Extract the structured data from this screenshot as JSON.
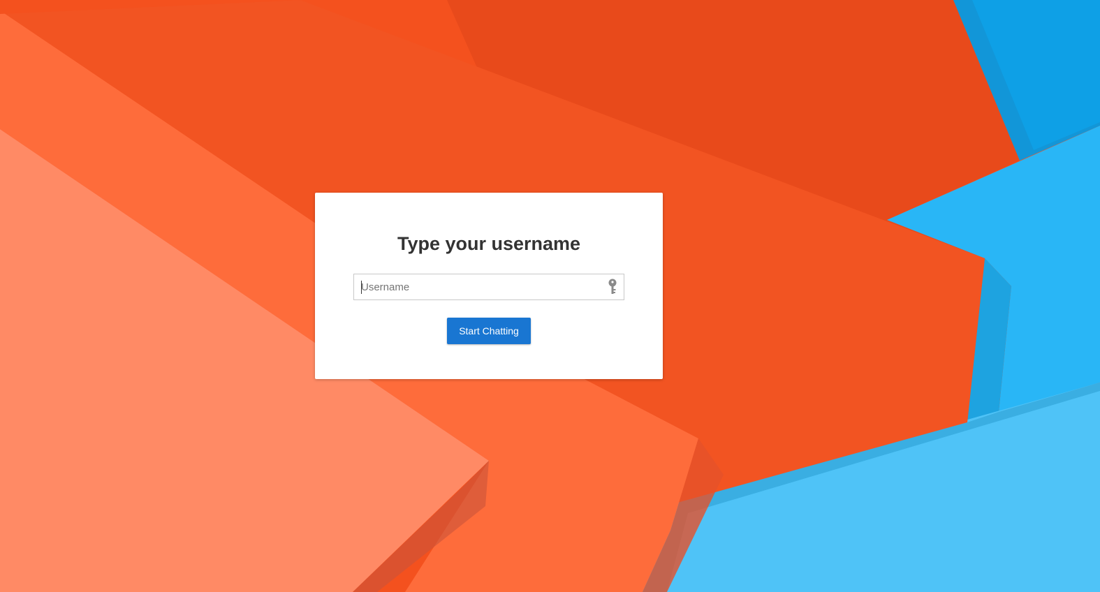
{
  "colors": {
    "accent": "#1976d2",
    "card_background": "#ffffff",
    "background_orange": "#f4511e",
    "background_blue": "#29b6f6"
  },
  "login": {
    "title": "Type your username",
    "username_input": {
      "placeholder": "Username",
      "value": "",
      "icon": "key-icon"
    },
    "start_button_label": "Start Chatting"
  }
}
